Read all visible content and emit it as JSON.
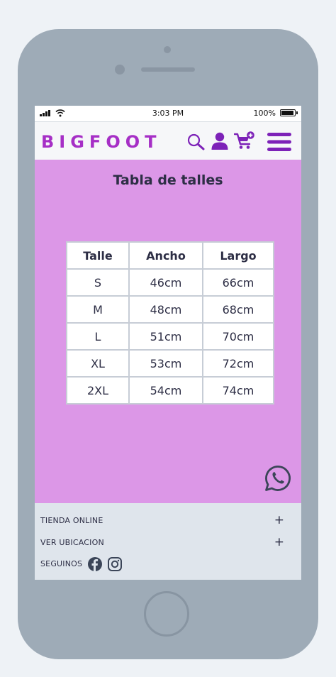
{
  "status_bar": {
    "time": "3:03 PM",
    "battery": "100%",
    "battery_level": 1.0
  },
  "header": {
    "brand": "BIGFOOT",
    "brand_color": "#a62fc6",
    "icons": [
      "search-icon",
      "user-icon",
      "cart-add-icon",
      "menu-icon"
    ]
  },
  "main": {
    "title": "Tabla de talles",
    "background": "#dc97e7",
    "table": {
      "headers": [
        "Talle",
        "Ancho",
        "Largo"
      ],
      "rows": [
        [
          "S",
          "46cm",
          "66cm"
        ],
        [
          "M",
          "48cm",
          "68cm"
        ],
        [
          "L",
          "51cm",
          "70cm"
        ],
        [
          "XL",
          "53cm",
          "72cm"
        ],
        [
          "2XL",
          "54cm",
          "74cm"
        ]
      ]
    }
  },
  "floating": {
    "icon": "whatsapp-icon"
  },
  "footer": {
    "items": [
      {
        "label": "TIENDA ONLINE",
        "action": "+"
      },
      {
        "label": "VER UBICACION",
        "action": "+"
      }
    ],
    "social_label": "SEGUINOS",
    "social_icons": [
      "facebook-icon",
      "instagram-icon"
    ]
  }
}
